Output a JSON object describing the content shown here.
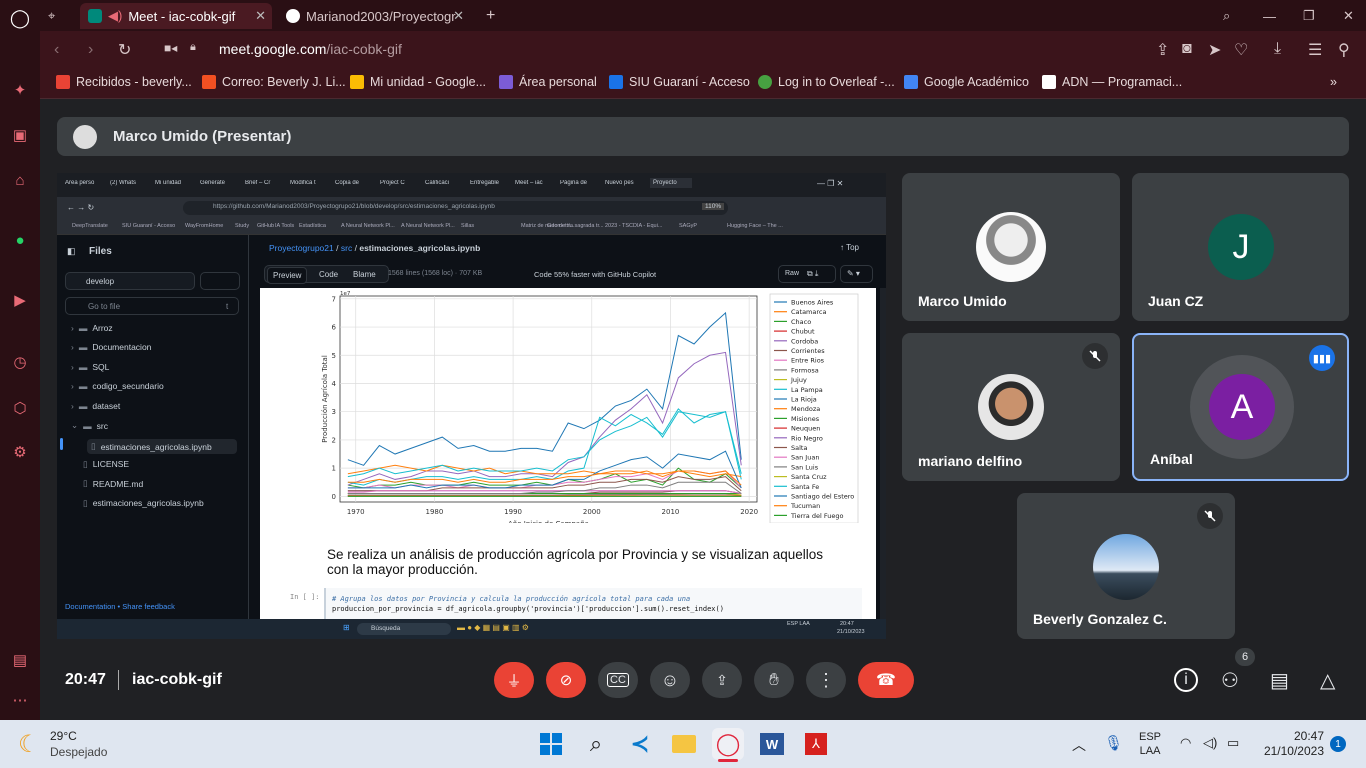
{
  "browser": {
    "tabs": [
      {
        "label": "Meet - iac-cobk-gif",
        "active": true
      },
      {
        "label": "Marianod2003/Proyectogr",
        "active": false
      }
    ],
    "address": {
      "host": "meet.google.com",
      "path": "/iac-cobk-gif"
    },
    "bookmarks": [
      {
        "label": "Recibidos - beverly...",
        "color": "#ea4335"
      },
      {
        "label": "Correo: Beverly J. Li...",
        "color": "#f25022"
      },
      {
        "label": "Mi unidad - Google...",
        "color": "#fbbc04"
      },
      {
        "label": "Área personal",
        "color": "#7c5cd6"
      },
      {
        "label": "SIU Guaraní - Acceso",
        "color": "#1a73e8"
      },
      {
        "label": "Log in to Overleaf -...",
        "color": "#47a141"
      },
      {
        "label": "Google Académico",
        "color": "#4285f4"
      },
      {
        "label": "ADN — Programaci...",
        "color": "#ffffff"
      }
    ]
  },
  "meet": {
    "presenter_label": "Marco Umido (Presentar)",
    "time": "20:47",
    "meeting_code": "iac-cobk-gif",
    "participants_count": "6",
    "participants": [
      {
        "name": "Marco Umido",
        "muted": false
      },
      {
        "name": "Juan CZ",
        "initial": "J",
        "muted": false
      },
      {
        "name": "mariano delfino",
        "muted": true
      },
      {
        "name": "Aníbal",
        "initial": "A",
        "muted": false,
        "speaking": true
      },
      {
        "name": "Beverly Gonzalez C.",
        "muted": true
      }
    ]
  },
  "shared": {
    "url": "https://github.com/Marianod2003/Proyectogrupo21/blob/develop/src/estimaciones_agricolas.ipynb",
    "zoom": "110%",
    "files_title": "Files",
    "branch": "develop",
    "goto_placeholder": "Go to file",
    "goto_key": "t",
    "tree": [
      {
        "label": "Arroz",
        "type": "folder",
        "indent": 0
      },
      {
        "label": "Documentacion",
        "type": "folder",
        "indent": 0
      },
      {
        "label": "SQL",
        "type": "folder",
        "indent": 0
      },
      {
        "label": "codigo_secundario",
        "type": "folder",
        "indent": 0
      },
      {
        "label": "dataset",
        "type": "folder",
        "indent": 0
      },
      {
        "label": "src",
        "type": "folder-open",
        "indent": 0
      },
      {
        "label": "estimaciones_agricolas.ipynb",
        "type": "file",
        "indent": 1,
        "selected": true
      },
      {
        "label": "LICENSE",
        "type": "file",
        "indent": 0
      },
      {
        "label": "README.md",
        "type": "file",
        "indent": 0
      },
      {
        "label": "estimaciones_agricolas.ipynb",
        "type": "file",
        "indent": 0
      }
    ],
    "footer_doc": "Documentation",
    "footer_sep": "•",
    "footer_feedback": "Share feedback",
    "breadcrumb_repo": "Proyectogrupo21",
    "breadcrumb_dir": "src",
    "breadcrumb_file": "estimaciones_agricolas.ipynb",
    "breadcrumb_sep": "/",
    "top_label": "Top",
    "view_tabs": [
      "Preview",
      "Code",
      "Blame"
    ],
    "file_info": "1568 lines (1568 loc) · 707 KB",
    "copilot": "Code 55% faster with GitHub Copilot",
    "raw_label": "Raw",
    "markdown_text": "Se realiza un análisis de producción agrícola por Provincia y se visualizan aquellos con la mayor producción.",
    "cell_prompt": "In [ ]:",
    "code_comment": "# Agrupa los datos por Provincia y calcula la producción agrícola total para cada una",
    "code_line": "produccion_por_provincia = df_agricola.groupby('provincia')['produccion'].sum().reset_index()",
    "inner_tabs": [
      "Área perso",
      "(2) Whats",
      "Mi unidad",
      "Generate",
      "Brief – Cr",
      "Modifica t",
      "Copia de",
      "Project C",
      "Calificaci",
      "Entregable",
      "Meet – iac",
      "Página de",
      "Nuevo pes",
      "Proyecto"
    ],
    "inner_bookmarks": [
      "DeepTranslate",
      "SIU Guaraní - Acceso",
      "WayFromHome",
      "Study",
      "GitHub",
      "IA Tools",
      "Estadística",
      "A Neural Network Pl...",
      "A Neural Network Pl...",
      "Sillas",
      "Matriz de nudo de tr...",
      "Geometría sagrada tr...",
      "2023 - TSCDIA - Equi...",
      "SAGyP",
      "Hugging Face – The ..."
    ],
    "inner_search": "Búsqueda",
    "inner_time": "20:47",
    "inner_date": "21/10/2023",
    "inner_lang": "ESP LAA"
  },
  "chart_data": {
    "type": "line",
    "title": "",
    "xlabel": "Año Inicio de Campaña",
    "ylabel": "Producción Agrícola Total",
    "y_offset_label": "1e7",
    "xlim": [
      1968,
      2021
    ],
    "ylim": [
      -0.2,
      7.1
    ],
    "xticks": [
      1970,
      1980,
      1990,
      2000,
      2010,
      2020
    ],
    "yticks": [
      0,
      1,
      2,
      3,
      4,
      5,
      6,
      7
    ],
    "legend_position": "right",
    "x": [
      1969,
      1971,
      1973,
      1975,
      1977,
      1979,
      1981,
      1983,
      1985,
      1987,
      1989,
      1991,
      1993,
      1995,
      1997,
      1999,
      2001,
      2003,
      2005,
      2007,
      2009,
      2011,
      2013,
      2015,
      2017,
      2019
    ],
    "series": [
      {
        "name": "Buenos Aires",
        "color": "#1f77b4",
        "values": [
          1.3,
          1.1,
          1.8,
          1.5,
          1.7,
          1.9,
          2.1,
          1.7,
          1.8,
          1.6,
          1.6,
          1.7,
          1.7,
          1.6,
          2.6,
          2.4,
          2.7,
          3.2,
          3.4,
          3.8,
          3.1,
          5.7,
          5.4,
          6.0,
          6.5,
          1.3
        ]
      },
      {
        "name": "Catamarca",
        "color": "#ff7f0e",
        "values": [
          0.02,
          0.02,
          0.03,
          0.03,
          0.03,
          0.03,
          0.03,
          0.03,
          0.04,
          0.04,
          0.04,
          0.04,
          0.05,
          0.05,
          0.05,
          0.05,
          0.06,
          0.06,
          0.06,
          0.07,
          0.07,
          0.07,
          0.08,
          0.08,
          0.08,
          0.05
        ]
      },
      {
        "name": "Chaco",
        "color": "#2ca02c",
        "values": [
          0.4,
          0.3,
          0.4,
          0.4,
          0.5,
          0.4,
          0.4,
          0.4,
          0.5,
          0.4,
          0.4,
          0.4,
          0.5,
          0.4,
          0.6,
          0.5,
          0.6,
          0.8,
          0.5,
          0.6,
          0.4,
          1.0,
          0.6,
          0.5,
          0.8,
          0.3
        ]
      },
      {
        "name": "Chubut",
        "color": "#d62728",
        "values": [
          0.01,
          0.01,
          0.01,
          0.01,
          0.01,
          0.01,
          0.01,
          0.01,
          0.01,
          0.01,
          0.01,
          0.01,
          0.01,
          0.01,
          0.01,
          0.01,
          0.01,
          0.01,
          0.01,
          0.01,
          0.01,
          0.01,
          0.01,
          0.01,
          0.01,
          0.01
        ]
      },
      {
        "name": "Cordoba",
        "color": "#9467bd",
        "values": [
          0.4,
          0.6,
          0.8,
          0.6,
          0.7,
          0.9,
          0.9,
          0.8,
          0.9,
          0.7,
          0.7,
          0.8,
          0.8,
          0.7,
          1.2,
          1.4,
          2.1,
          2.7,
          3.1,
          3.6,
          2.6,
          4.2,
          4.7,
          5.0,
          5.1,
          1.1
        ]
      },
      {
        "name": "Corrientes",
        "color": "#8c564b",
        "values": [
          0.1,
          0.1,
          0.1,
          0.1,
          0.1,
          0.1,
          0.1,
          0.1,
          0.1,
          0.1,
          0.1,
          0.1,
          0.1,
          0.1,
          0.1,
          0.1,
          0.15,
          0.15,
          0.15,
          0.15,
          0.15,
          0.2,
          0.2,
          0.2,
          0.2,
          0.1
        ]
      },
      {
        "name": "Entre Rios",
        "color": "#e377c2",
        "values": [
          0.3,
          0.3,
          0.4,
          0.3,
          0.4,
          0.4,
          0.4,
          0.3,
          0.4,
          0.3,
          0.3,
          0.3,
          0.4,
          0.4,
          0.5,
          0.5,
          0.6,
          0.7,
          0.7,
          0.8,
          0.6,
          0.9,
          0.9,
          0.8,
          0.9,
          0.3
        ]
      },
      {
        "name": "Formosa",
        "color": "#7f7f7f",
        "values": [
          0.05,
          0.05,
          0.05,
          0.05,
          0.05,
          0.05,
          0.05,
          0.05,
          0.05,
          0.05,
          0.05,
          0.05,
          0.05,
          0.05,
          0.06,
          0.06,
          0.06,
          0.06,
          0.07,
          0.07,
          0.07,
          0.08,
          0.08,
          0.08,
          0.08,
          0.04
        ]
      },
      {
        "name": "Jujuy",
        "color": "#bcbd22",
        "values": [
          0.1,
          0.1,
          0.1,
          0.1,
          0.1,
          0.1,
          0.1,
          0.1,
          0.1,
          0.1,
          0.1,
          0.1,
          0.1,
          0.1,
          0.1,
          0.1,
          0.1,
          0.1,
          0.1,
          0.1,
          0.1,
          0.1,
          0.1,
          0.1,
          0.1,
          0.05
        ]
      },
      {
        "name": "La Pampa",
        "color": "#17becf",
        "values": [
          0.5,
          0.4,
          0.6,
          0.5,
          0.6,
          0.7,
          0.7,
          0.6,
          0.7,
          0.6,
          0.6,
          0.6,
          0.7,
          0.6,
          0.9,
          1.0,
          2.8,
          2.5,
          2.9,
          2.6,
          2.2,
          3.1,
          2.6,
          2.9,
          3.0,
          0.6
        ]
      },
      {
        "name": "La Rioja",
        "color": "#1f77b4",
        "values": [
          0.01,
          0.01,
          0.01,
          0.01,
          0.01,
          0.01,
          0.01,
          0.01,
          0.01,
          0.01,
          0.01,
          0.01,
          0.01,
          0.01,
          0.01,
          0.01,
          0.01,
          0.01,
          0.01,
          0.01,
          0.01,
          0.01,
          0.01,
          0.01,
          0.01,
          0.01
        ]
      },
      {
        "name": "Mendoza",
        "color": "#ff7f0e",
        "values": [
          0.8,
          0.9,
          1.0,
          1.1,
          1.0,
          0.9,
          1.1,
          1.0,
          0.9,
          1.0,
          0.8,
          0.9,
          0.8,
          0.8,
          0.8,
          0.9,
          0.8,
          0.9,
          0.9,
          0.8,
          0.8,
          0.9,
          0.8,
          0.7,
          0.8,
          0.7
        ]
      },
      {
        "name": "Misiones",
        "color": "#2ca02c",
        "values": [
          0.1,
          0.1,
          0.1,
          0.1,
          0.1,
          0.1,
          0.1,
          0.1,
          0.1,
          0.1,
          0.1,
          0.1,
          0.1,
          0.1,
          0.1,
          0.1,
          0.1,
          0.1,
          0.1,
          0.1,
          0.1,
          0.1,
          0.1,
          0.1,
          0.1,
          0.1
        ]
      },
      {
        "name": "Neuquen",
        "color": "#d62728",
        "values": [
          0.02,
          0.02,
          0.02,
          0.02,
          0.02,
          0.02,
          0.02,
          0.02,
          0.02,
          0.02,
          0.02,
          0.02,
          0.02,
          0.02,
          0.02,
          0.02,
          0.02,
          0.02,
          0.02,
          0.02,
          0.02,
          0.02,
          0.02,
          0.02,
          0.02,
          0.02
        ]
      },
      {
        "name": "Rio Negro",
        "color": "#9467bd",
        "values": [
          0.2,
          0.2,
          0.2,
          0.2,
          0.2,
          0.2,
          0.2,
          0.2,
          0.2,
          0.2,
          0.2,
          0.2,
          0.2,
          0.2,
          0.2,
          0.2,
          0.2,
          0.2,
          0.2,
          0.2,
          0.2,
          0.2,
          0.2,
          0.2,
          0.2,
          0.1
        ]
      },
      {
        "name": "Salta",
        "color": "#8c564b",
        "values": [
          0.2,
          0.2,
          0.2,
          0.2,
          0.2,
          0.2,
          0.3,
          0.3,
          0.3,
          0.3,
          0.3,
          0.3,
          0.3,
          0.3,
          0.4,
          0.4,
          0.5,
          0.5,
          0.6,
          0.6,
          0.5,
          0.7,
          0.6,
          0.6,
          0.7,
          0.2
        ]
      },
      {
        "name": "San Juan",
        "color": "#e377c2",
        "values": [
          0.15,
          0.15,
          0.2,
          0.2,
          0.2,
          0.2,
          0.2,
          0.2,
          0.2,
          0.2,
          0.2,
          0.2,
          0.2,
          0.2,
          0.2,
          0.2,
          0.2,
          0.2,
          0.2,
          0.2,
          0.2,
          0.2,
          0.2,
          0.2,
          0.2,
          0.1
        ]
      },
      {
        "name": "San Luis",
        "color": "#7f7f7f",
        "values": [
          0.1,
          0.1,
          0.1,
          0.1,
          0.1,
          0.1,
          0.1,
          0.1,
          0.1,
          0.1,
          0.1,
          0.1,
          0.15,
          0.15,
          0.2,
          0.2,
          0.3,
          0.3,
          0.4,
          0.4,
          0.3,
          0.5,
          0.5,
          0.5,
          0.5,
          0.1
        ]
      },
      {
        "name": "Santa Cruz",
        "color": "#bcbd22",
        "values": [
          0.01,
          0.01,
          0.01,
          0.01,
          0.01,
          0.01,
          0.01,
          0.01,
          0.01,
          0.01,
          0.01,
          0.01,
          0.01,
          0.01,
          0.01,
          0.01,
          0.01,
          0.01,
          0.01,
          0.01,
          0.01,
          0.01,
          0.01,
          0.01,
          0.01,
          0.01
        ]
      },
      {
        "name": "Santa Fe",
        "color": "#17becf",
        "values": [
          0.7,
          0.8,
          1.0,
          0.8,
          0.9,
          1.0,
          1.1,
          0.9,
          1.0,
          0.9,
          0.9,
          0.9,
          1.0,
          0.9,
          1.3,
          1.4,
          2.0,
          2.3,
          2.5,
          2.8,
          2.1,
          3.0,
          2.9,
          2.8,
          3.0,
          0.8
        ]
      },
      {
        "name": "Santiago del Estero",
        "color": "#1f77b4",
        "values": [
          0.3,
          0.3,
          0.3,
          0.3,
          0.4,
          0.3,
          0.4,
          0.4,
          0.4,
          0.3,
          0.3,
          0.4,
          0.4,
          0.4,
          0.6,
          0.6,
          0.9,
          1.1,
          1.3,
          1.4,
          1.0,
          1.5,
          1.4,
          1.3,
          1.6,
          0.3
        ]
      },
      {
        "name": "Tucuman",
        "color": "#ff7f0e",
        "values": [
          0.5,
          0.5,
          0.6,
          0.5,
          0.6,
          0.6,
          0.6,
          0.5,
          0.6,
          0.5,
          0.5,
          0.6,
          0.6,
          0.6,
          0.7,
          0.7,
          0.8,
          0.8,
          0.8,
          0.9,
          0.7,
          0.9,
          0.9,
          0.8,
          0.9,
          0.4
        ]
      },
      {
        "name": "Tierra del Fuego",
        "color": "#2ca02c",
        "values": [
          0.0,
          0.0,
          0.0,
          0.0,
          0.0,
          0.0,
          0.0,
          0.0,
          0.0,
          0.0,
          0.0,
          0.0,
          0.0,
          0.0,
          0.0,
          0.0,
          0.0,
          0.0,
          0.0,
          0.0,
          0.0,
          0.0,
          0.0,
          0.0,
          0.0,
          0.0
        ]
      }
    ]
  },
  "taskbar": {
    "weather_temp": "29°C",
    "weather_desc": "Despejado",
    "lang_top": "ESP",
    "lang_bottom": "LAA",
    "time": "20:47",
    "date": "21/10/2023",
    "notif_count": "1"
  }
}
